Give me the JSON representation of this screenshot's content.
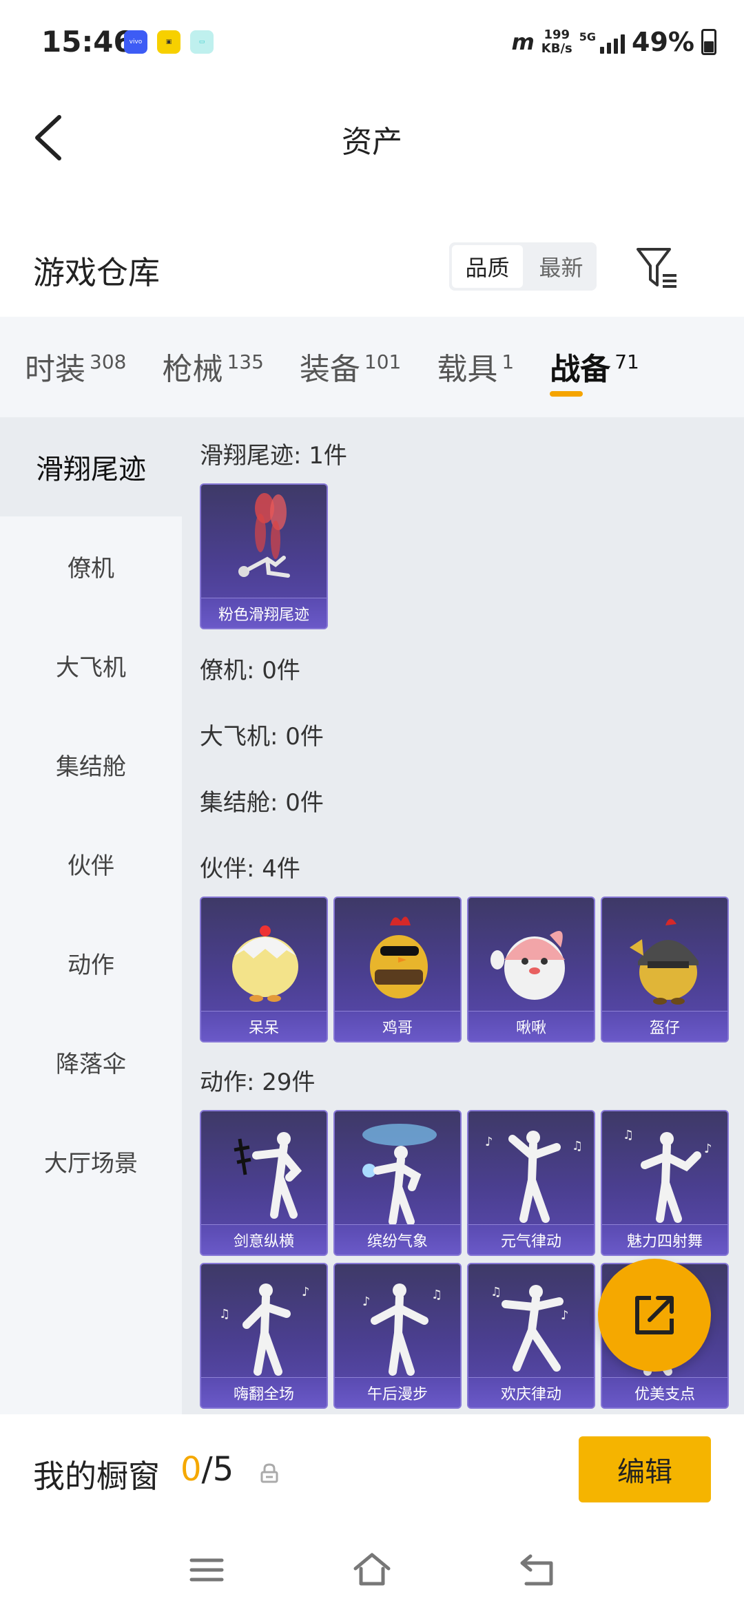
{
  "status": {
    "time": "15:46",
    "net_speed_value": "199",
    "net_speed_unit": "KB/s",
    "signal_type": "5G",
    "battery": "49%",
    "battery_level": 0.49,
    "icons": [
      "vivo-icon",
      "game-app-icon",
      "chat-app-icon",
      "hd-network-icon",
      "signal-icon",
      "battery-icon"
    ]
  },
  "header": {
    "title": "资产"
  },
  "warehouse": {
    "title": "游戏仓库",
    "sort_options": [
      "品质",
      "最新"
    ],
    "sort_active": "品质"
  },
  "categories": [
    {
      "label": "时装",
      "count": "308"
    },
    {
      "label": "枪械",
      "count": "135"
    },
    {
      "label": "装备",
      "count": "101"
    },
    {
      "label": "载具",
      "count": "1"
    },
    {
      "label": "战备",
      "count": "71",
      "active": true
    }
  ],
  "side_menu": [
    {
      "label": "滑翔尾迹",
      "active": true
    },
    {
      "label": "僚机"
    },
    {
      "label": "大飞机"
    },
    {
      "label": "集结舱"
    },
    {
      "label": "伙伴"
    },
    {
      "label": "动作"
    },
    {
      "label": "降落伞"
    },
    {
      "label": "大厅场景"
    }
  ],
  "sections": {
    "trail": {
      "heading": "滑翔尾迹: 1件",
      "items": [
        "粉色滑翔尾迹"
      ]
    },
    "wingman": {
      "heading": "僚机: 0件"
    },
    "plane": {
      "heading": "大飞机: 0件"
    },
    "pod": {
      "heading": "集结舱: 0件"
    },
    "companion": {
      "heading": "伙伴: 4件",
      "items": [
        "呆呆",
        "鸡哥",
        "啾啾",
        "盔仔"
      ]
    },
    "emote": {
      "heading": "动作: 29件",
      "items": [
        "剑意纵横",
        "缤纷气象",
        "元气律动",
        "魅力四射舞",
        "嗨翻全场",
        "午后漫步",
        "欢庆律动",
        "优美支点"
      ]
    }
  },
  "showcase": {
    "title": "我的橱窗",
    "current": "0",
    "separator": "/",
    "total": "5",
    "edit_label": "编辑"
  },
  "colors": {
    "accent": "#f5a800",
    "card_purple": "#4b3f91",
    "panel_bg": "#e9ecf0",
    "side_bg": "#f4f6f9"
  }
}
